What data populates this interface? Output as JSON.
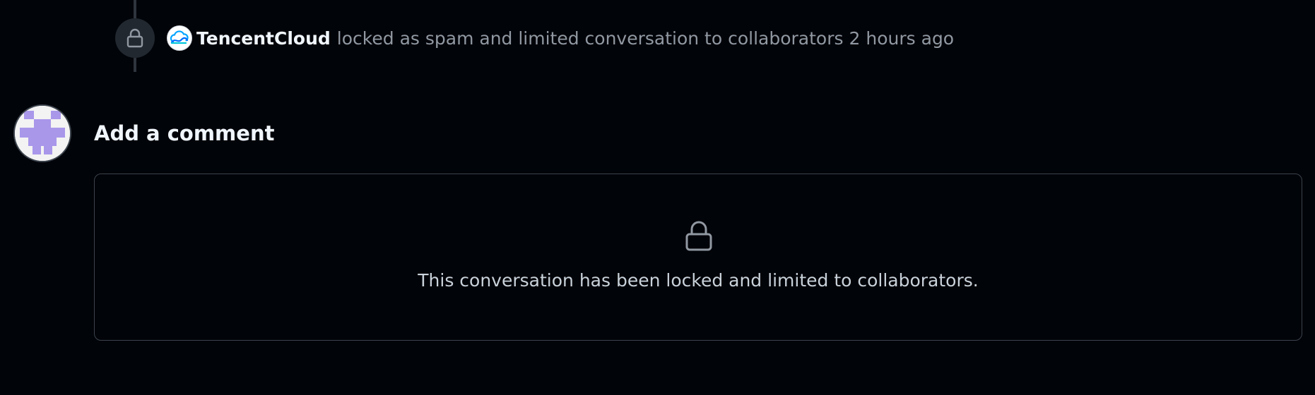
{
  "timeline_event": {
    "icon": "lock-icon",
    "actor": "TencentCloud",
    "actor_avatar_icon": "cloud-icon",
    "description": "locked as spam and limited conversation to collaborators",
    "time": "2 hours ago"
  },
  "comment_section": {
    "title": "Add a comment",
    "user_avatar": "identicon-avatar",
    "locked_icon": "lock-icon",
    "locked_message": "This conversation has been locked and limited to collaborators."
  },
  "colors": {
    "background": "#010409",
    "border": "#3d444d",
    "muted_text": "#9198a1",
    "identicon": "#a997ea"
  }
}
